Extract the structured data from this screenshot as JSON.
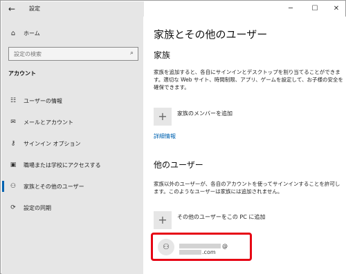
{
  "titlebar": {
    "title": "設定",
    "back_icon": "←",
    "minimize_icon": "─",
    "maximize_icon": "☐",
    "close_icon": "✕"
  },
  "sidebar": {
    "home_label": "ホーム",
    "home_icon": "⌂",
    "search_placeholder": "設定の検索",
    "search_icon": "⌕",
    "section_header": "アカウント",
    "items": [
      {
        "label": "ユーザーの情報",
        "icon": "☷"
      },
      {
        "label": "メールとアカウント",
        "icon": "✉"
      },
      {
        "label": "サインイン オプション",
        "icon": "⚷"
      },
      {
        "label": "職場または学校にアクセスする",
        "icon": "▣"
      },
      {
        "label": "家族とその他のユーザー",
        "icon": "⚇"
      },
      {
        "label": "設定の同期",
        "icon": "⟳"
      }
    ],
    "accent_color": "#0063b1"
  },
  "main": {
    "page_title": "家族とその他のユーザー",
    "family": {
      "heading": "家族",
      "description": "家族を追加すると、各自にサインインとデスクトップを割り当てることができます。適切な Web サイト、時間制限、アプリ、ゲームを設定して、お子様の安全を確保できます。",
      "add_label": "家族のメンバーを追加",
      "add_icon": "+",
      "more_info": "詳細情報"
    },
    "others": {
      "heading": "他のユーザー",
      "description": "家族以外のユーザーが、各自のアカウントを使ってサインインすることを許可します。このようなユーザーは家族には追加されません。",
      "add_label": "その他のユーザーをこの PC に追加",
      "add_icon": "+",
      "user_email_at": "@",
      "user_email_suffix": ".com",
      "user_icon": "⚇",
      "highlight_color": "#e60012"
    }
  }
}
